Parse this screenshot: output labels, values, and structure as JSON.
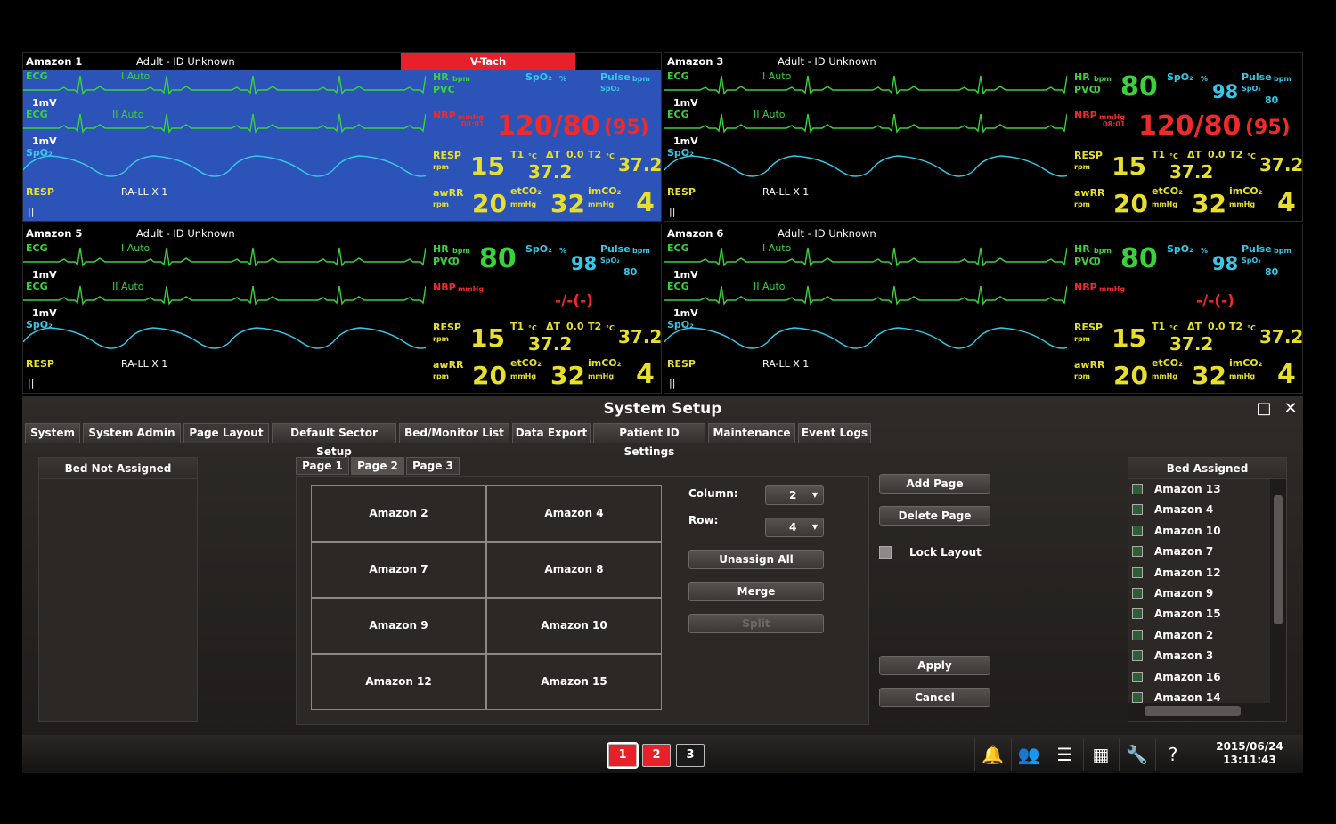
{
  "sectors": [
    {
      "bed": "Amazon 1",
      "patient": "Adult - ID Unknown",
      "alarm": "V-Tach",
      "hr": "",
      "pulse": "",
      "spo2": "",
      "nbp": "120/80",
      "nbp_mean": "(95)",
      "nbp_time": "08:01",
      "resp": "15",
      "t1": "37.2",
      "dt": "0.0",
      "t2": "37.2",
      "awrr": "20",
      "etco2": "32",
      "imco2": "4",
      "pvc": "",
      "ecg1_lead": "I  Auto",
      "ecg2_lead": "II  Auto",
      "resp_lead": "RA-LL X 1"
    },
    {
      "bed": "Amazon 3",
      "patient": "Adult - ID Unknown",
      "alarm": "",
      "hr": "80",
      "pulse": "80",
      "spo2": "98",
      "nbp": "120/80",
      "nbp_mean": "(95)",
      "nbp_time": "08:01",
      "resp": "15",
      "t1": "37.2",
      "dt": "0.0",
      "t2": "37.2",
      "awrr": "20",
      "etco2": "32",
      "imco2": "4",
      "pvc": "0",
      "ecg1_lead": "I  Auto",
      "ecg2_lead": "II  Auto",
      "resp_lead": "RA-LL X 1"
    },
    {
      "bed": "Amazon 5",
      "patient": "Adult - ID Unknown",
      "alarm": "",
      "hr": "80",
      "pulse": "80",
      "spo2": "98",
      "nbp": "-/-(-)",
      "nbp_mean": "",
      "nbp_time": "",
      "resp": "15",
      "t1": "37.2",
      "dt": "0.0",
      "t2": "37.2",
      "awrr": "20",
      "etco2": "32",
      "imco2": "4",
      "pvc": "0",
      "ecg1_lead": "I  Auto",
      "ecg2_lead": "II  Auto",
      "resp_lead": "RA-LL X 1"
    },
    {
      "bed": "Amazon 6",
      "patient": "Adult - ID Unknown",
      "alarm": "",
      "hr": "80",
      "pulse": "80",
      "spo2": "98",
      "nbp": "-/-(-)",
      "nbp_mean": "",
      "nbp_time": "",
      "resp": "15",
      "t1": "37.2",
      "dt": "0.0",
      "t2": "37.2",
      "awrr": "20",
      "etco2": "32",
      "imco2": "4",
      "pvc": "0",
      "ecg1_lead": "I  Auto",
      "ecg2_lead": "II  Auto",
      "resp_lead": "RA-LL X 1"
    }
  ],
  "labels": {
    "ecg": "ECG",
    "spo2": "SpO₂",
    "resp": "RESP",
    "scale": "1mV",
    "hr": "HR",
    "bpm": "bpm",
    "pvc": "PVC",
    "spo2_pct": "%",
    "pulse": "Pulse",
    "nbp": "NBP",
    "mmhg": "mmHg",
    "rpm": "rpm",
    "t1": "T1",
    "t2": "T2",
    "degc": "°C",
    "dt": "ΔT",
    "awrr": "awRR",
    "etco2": "etCO₂",
    "imco2": "imCO₂",
    "resp_marker": "||",
    "pulse_src": "SpO₂"
  },
  "setup": {
    "title": "System Setup",
    "tabs": [
      "System",
      "System Admin",
      "Page Layout",
      "Default Sector Setup",
      "Bed/Monitor List",
      "Data Export",
      "Patient ID Settings",
      "Maintenance",
      "Event Logs"
    ],
    "active_tab": "Page Layout",
    "bed_not_assigned": "Bed Not Assigned",
    "page_tabs": [
      "Page 1",
      "Page 2",
      "Page 3"
    ],
    "active_page": "Page 2",
    "layout_cells": [
      "Amazon 2",
      "Amazon 4",
      "Amazon 7",
      "Amazon 8",
      "Amazon 9",
      "Amazon 10",
      "Amazon 12",
      "Amazon 15"
    ],
    "column_label": "Column:",
    "column_value": "2",
    "row_label": "Row:",
    "row_value": "4",
    "unassign_all": "Unassign All",
    "merge": "Merge",
    "split": "Split",
    "add_page": "Add Page",
    "delete_page": "Delete Page",
    "lock_layout": "Lock Layout",
    "apply": "Apply",
    "cancel": "Cancel",
    "bed_assigned": "Bed Assigned",
    "bed_assigned_list": [
      "Amazon 13",
      "Amazon 4",
      "Amazon 10",
      "Amazon 7",
      "Amazon 12",
      "Amazon 9",
      "Amazon 15",
      "Amazon 2",
      "Amazon 3",
      "Amazon 16",
      "Amazon 14"
    ]
  },
  "footer": {
    "pages": [
      "1",
      "2",
      "3"
    ],
    "date": "2015/06/24",
    "time": "13:11:43",
    "icons": [
      "bell-icon",
      "patients-icon",
      "list-icon",
      "grid-icon",
      "wrench-icon",
      "help-icon"
    ]
  },
  "colors": {
    "alarm": "#e8202a",
    "ecg": "#38d23a",
    "spo2": "#35c8e8",
    "nbp": "#f02a2a",
    "resp": "#e8df2c",
    "blue_sector": "#2c54b8"
  }
}
